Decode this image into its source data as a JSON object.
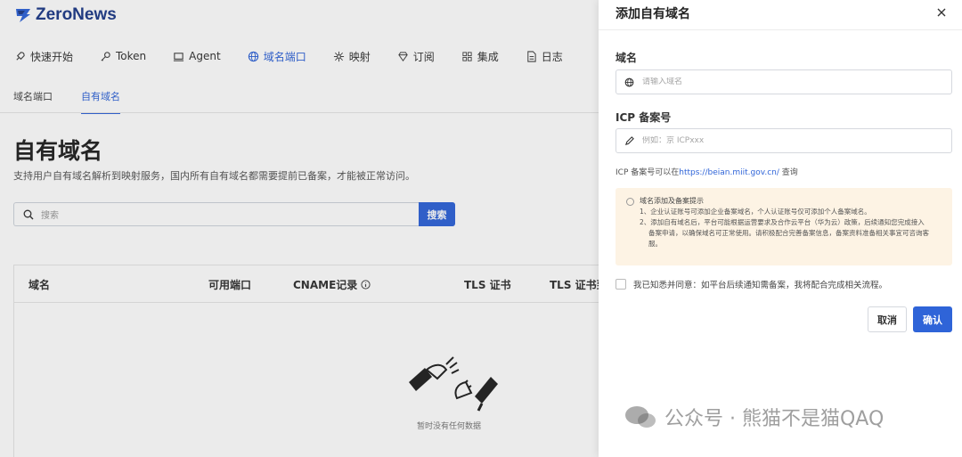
{
  "app": {
    "brand": "ZeroNews"
  },
  "nav": {
    "items": [
      {
        "label": "快速开始",
        "icon": "rocket-icon"
      },
      {
        "label": "Token",
        "icon": "key-icon"
      },
      {
        "label": "Agent",
        "icon": "monitor-icon"
      },
      {
        "label": "域名端口",
        "icon": "globe-icon",
        "active": true
      },
      {
        "label": "映射",
        "icon": "network-icon"
      },
      {
        "label": "订阅",
        "icon": "diamond-icon"
      },
      {
        "label": "集成",
        "icon": "grid-icon"
      },
      {
        "label": "日志",
        "icon": "file-icon"
      }
    ]
  },
  "subtabs": {
    "domain_port": "域名端口",
    "own_domain": "自有域名"
  },
  "page": {
    "title": "自有域名",
    "description": "支持用户自有域名解析到映射服务，国内所有自有域名都需要提前已备案，才能被正常访问。",
    "search_placeholder": "搜索",
    "search_button": "搜索"
  },
  "table": {
    "columns": [
      "域名",
      "可用端口",
      "CNAME记录",
      "TLS 证书",
      "TLS 证书到"
    ],
    "empty_text": "暂时没有任何数据"
  },
  "drawer": {
    "title": "添加自有域名",
    "domain_label": "域名",
    "domain_placeholder": "请输入域名",
    "icp_label": "ICP 备案号",
    "icp_placeholder": "例如：京 ICPxxx",
    "icp_hint_prefix": "ICP 备案号可以在",
    "icp_hint_link": "https://beian.miit.gov.cn/",
    "icp_hint_suffix": " 查询",
    "notice_title": "域名添加及备案提示",
    "notice_line1": "1、企业认证账号可添加企业备案域名，个人认证账号仅可添加个人备案域名。",
    "notice_line2a": "2、添加自有域名后，平台可能根据运营要求及合作云平台（华为云）政策，后续通知您完成接入",
    "notice_line2b": "备案申请，以确保域名可正常使用。请积极配合完善备案信息，备案资料准备相关事宜可咨询客",
    "notice_line2c": "服。",
    "agree_text": "我已知悉并同意：如平台后续通知需备案，我将配合完成相关流程。",
    "cancel": "取消",
    "confirm": "确认"
  },
  "watermark": {
    "text": "公众号 · 熊猫不是猫QAQ"
  },
  "colors": {
    "accent": "#2f64d8",
    "notice_bg": "#fdf3e4"
  }
}
